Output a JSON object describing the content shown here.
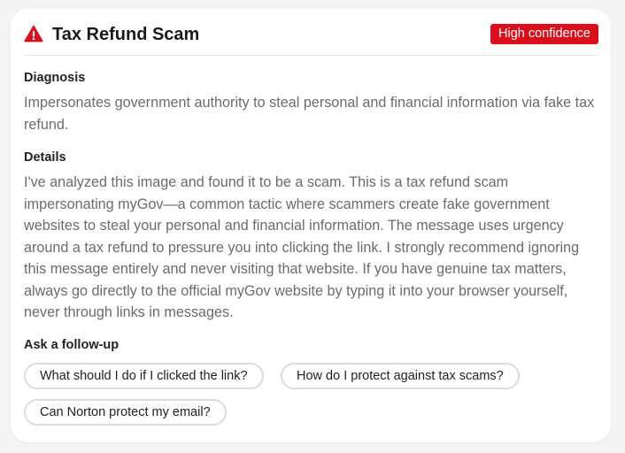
{
  "header": {
    "title": "Tax Refund Scam",
    "icon": "warning-triangle-icon",
    "badge": "High confidence",
    "badge_color": "#d90f1c"
  },
  "diagnosis": {
    "label": "Diagnosis",
    "text": "Impersonates government authority to steal personal and financial information via fake tax refund."
  },
  "details": {
    "label": "Details",
    "text": "I've analyzed this image and found it to be a scam. This is a tax refund scam impersonating myGov—a common tactic where scammers create fake government websites to steal your personal and financial information. The message uses urgency around a tax refund to pressure you into clicking the link. I strongly recommend ignoring this message entirely and never visiting that website. If you have genuine tax matters, always go directly to the official myGov website by typing it into your browser yourself, never through links in messages."
  },
  "followup": {
    "label": "Ask a follow-up",
    "chips": [
      "What should I do if I clicked the link?",
      "How do I protect against tax scams?",
      "Can Norton protect my email?"
    ]
  }
}
